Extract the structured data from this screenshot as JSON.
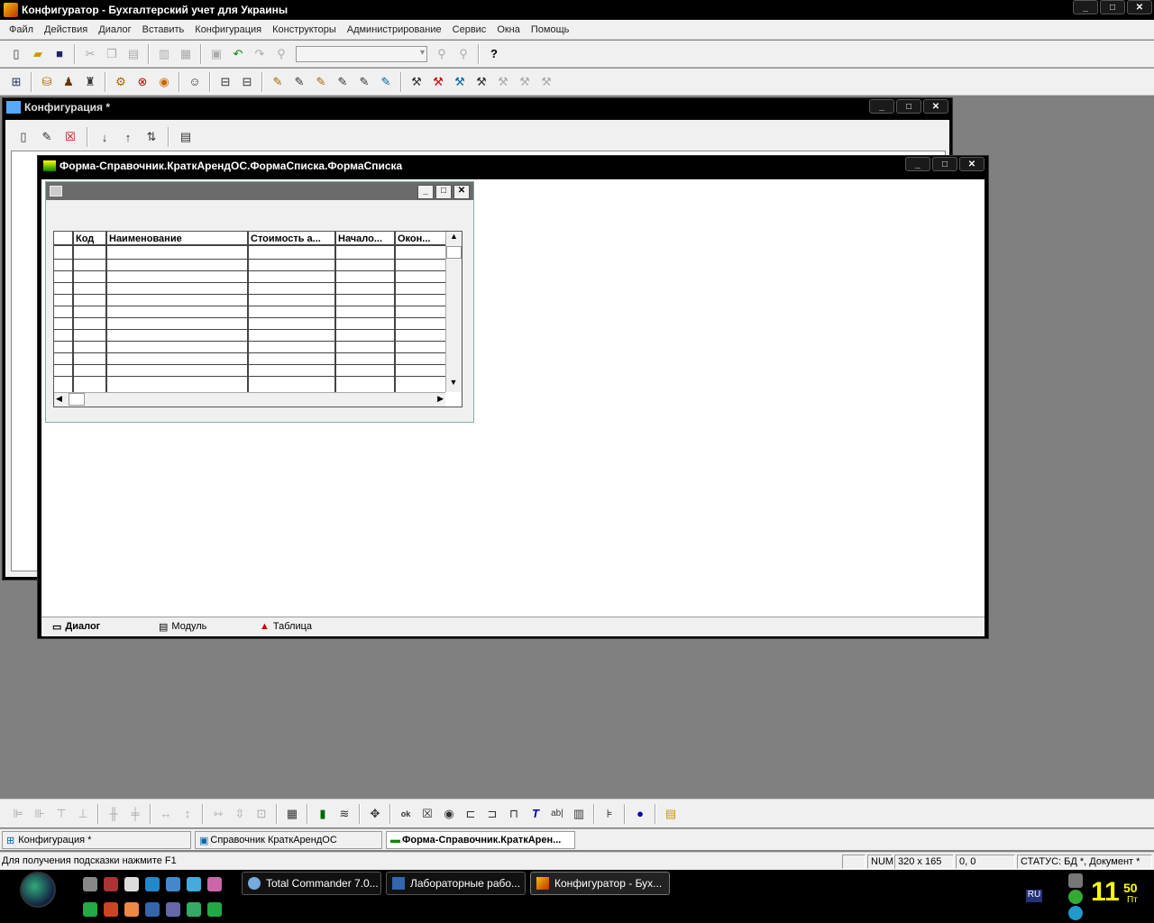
{
  "app": {
    "title": "Конфигуратор - Бухгалтерский учет для Украины"
  },
  "menu": [
    "Файл",
    "Действия",
    "Диалог",
    "Вставить",
    "Конфигурация",
    "Конструкторы",
    "Администрирование",
    "Сервис",
    "Окна",
    "Помощь"
  ],
  "config_window": {
    "title": "Конфигурация *"
  },
  "form_window": {
    "title": "Форма-Справочник.КраткАрендОС.ФормаСписка.ФормаСписка"
  },
  "grid": {
    "columns": [
      "Код",
      "Наименование",
      "Стоимость а...",
      "Начало...",
      "Окон..."
    ]
  },
  "form_tabs": [
    "Диалог",
    "Модуль",
    "Таблица"
  ],
  "window_tabs": [
    "Конфигурация *",
    "Справочник КраткАрендОС",
    "Форма-Справочник.КраткАрен..."
  ],
  "status": {
    "hint": "Для получения подсказки нажмите F1",
    "num": "NUM",
    "size": "320 x 165",
    "pos": "0, 0",
    "state": "СТАТУС: БД *, Документ *"
  },
  "taskbar": {
    "buttons": [
      "Total Commander 7.0...",
      "Лабораторные рабо...",
      "Конфигуратор - Бух..."
    ],
    "lang": "RU",
    "clock_hour": "11",
    "clock_min": "50",
    "clock_day": "Пт"
  },
  "window_buttons": {
    "min": "_",
    "max": "□",
    "close": "✕"
  }
}
